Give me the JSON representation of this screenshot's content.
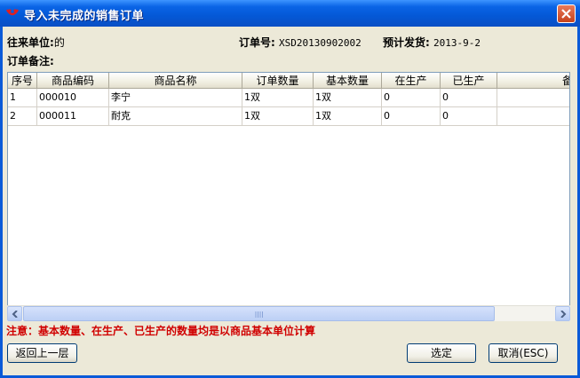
{
  "window": {
    "title": "导入未完成的销售订单"
  },
  "info": {
    "partner_label": "往来单位:",
    "partner_value": "的",
    "order_no_label": "订单号:",
    "order_no_value": "XSD20130902002",
    "ship_label": "预计发货:",
    "ship_value": "2013-9-2",
    "remark_label": "订单备注:"
  },
  "table": {
    "headers": [
      "序号",
      "商品编码",
      "商品名称",
      "订单数量",
      "基本数量",
      "在生产",
      "已生产",
      "备注"
    ],
    "rows": [
      [
        "1",
        "000010",
        "李宁",
        "1双",
        "1双",
        "0",
        "0",
        ""
      ],
      [
        "2",
        "000011",
        "耐克",
        "1双",
        "1双",
        "0",
        "0",
        ""
      ]
    ]
  },
  "note": "注意：基本数量、在生产、已生产的数量均是以商品基本单位计算",
  "buttons": {
    "back": "返回上一层",
    "select": "选定",
    "cancel": "取消(ESC)"
  },
  "colors": {
    "title_bar": "#0a5ad8",
    "note_text": "#d00000",
    "dialog_bg": "#ece9d8"
  },
  "icons": {
    "app": "app-logo-icon",
    "close": "close-icon"
  }
}
